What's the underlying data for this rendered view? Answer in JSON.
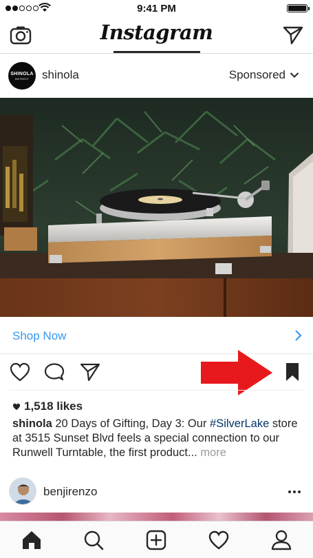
{
  "status_bar": {
    "time": "9:41 PM",
    "signal_icon": "signal-dots-icon",
    "wifi_icon": "wifi-icon",
    "battery_icon": "battery-icon"
  },
  "nav": {
    "logo": "Instagram",
    "left_icon": "camera-icon",
    "right_icon": "direct-message-icon"
  },
  "post": {
    "avatar_text_line1": "SHINOLA",
    "avatar_text_line2": "DETROIT",
    "username": "shinola",
    "sponsored_label": "Sponsored",
    "shop_now_label": "Shop Now",
    "actions": [
      "heart-icon",
      "comment-icon",
      "share-icon",
      "bookmark-icon"
    ],
    "likes": "1,518 likes",
    "caption": {
      "user": "shinola",
      "text_before": " 20 Days of Gifting, Day 3: Our ",
      "hashtag": "#SilverLake",
      "text_after": " store at 3515 Sunset Blvd feels a special connection to our Runwell Turntable, the first product... ",
      "more": "more"
    }
  },
  "next_post": {
    "username": "benjirenzo"
  },
  "tabbar": {
    "tabs": [
      "home-icon",
      "search-icon",
      "add-post-icon",
      "activity-icon",
      "profile-icon"
    ],
    "active": "home-icon"
  },
  "colors": {
    "link_blue": "#3897f0",
    "hashtag": "#003569",
    "annotation_red": "#e8191c",
    "text": "#262626",
    "muted": "#999999"
  }
}
